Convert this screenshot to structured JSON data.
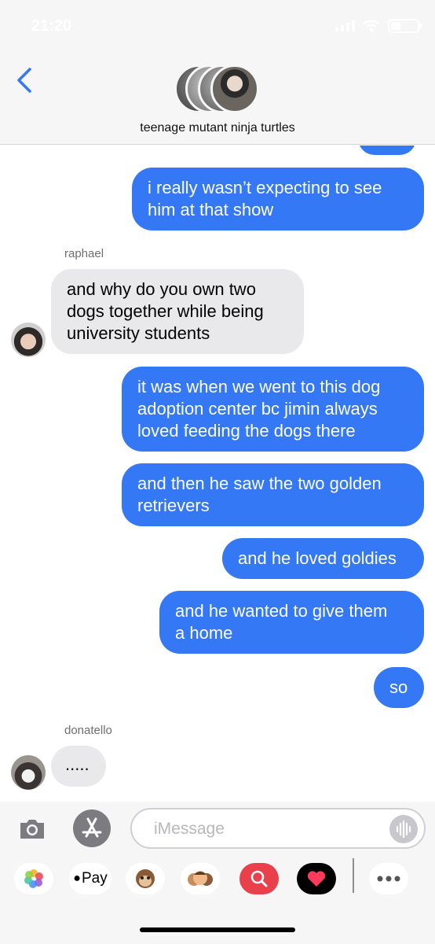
{
  "status_bar": {
    "time": "21:20"
  },
  "header": {
    "group_name": "teenage mutant ninja turtles"
  },
  "messages": [
    {
      "type": "sent",
      "text_lines": [
        "i really wasn’t expecting to see",
        "him at that show"
      ]
    },
    {
      "type": "label",
      "sender": "raphael"
    },
    {
      "type": "recv",
      "text_lines": [
        "and why do you own two",
        "dogs together while being",
        "university students"
      ]
    },
    {
      "type": "sent",
      "text_lines": [
        "it was when we went to this dog",
        "adoption center bc jimin always",
        "loved feeding the dogs there"
      ]
    },
    {
      "type": "sent",
      "text_lines": [
        "and then he saw the two golden",
        "retrievers"
      ]
    },
    {
      "type": "sent",
      "text_lines": [
        "and he loved goldies"
      ]
    },
    {
      "type": "sent",
      "text_lines": [
        "and he wanted to give them",
        "a home"
      ]
    },
    {
      "type": "sent",
      "text_lines": [
        "so"
      ]
    },
    {
      "type": "label",
      "sender": "donatello"
    },
    {
      "type": "recv",
      "text_lines": [
        "....."
      ]
    }
  ],
  "composer": {
    "placeholder": "iMessage",
    "apps": [
      "photos-icon",
      "apple-pay-icon",
      "animoji-icon",
      "memoji-icon",
      "web-search-icon",
      "digital-touch-icon",
      "more-icon"
    ],
    "pay_label": "Pay"
  },
  "colors": {
    "sent_bubble": "#3478f6",
    "received_bubble": "#e9e9eb",
    "header_bg": "#f6f6f6"
  }
}
